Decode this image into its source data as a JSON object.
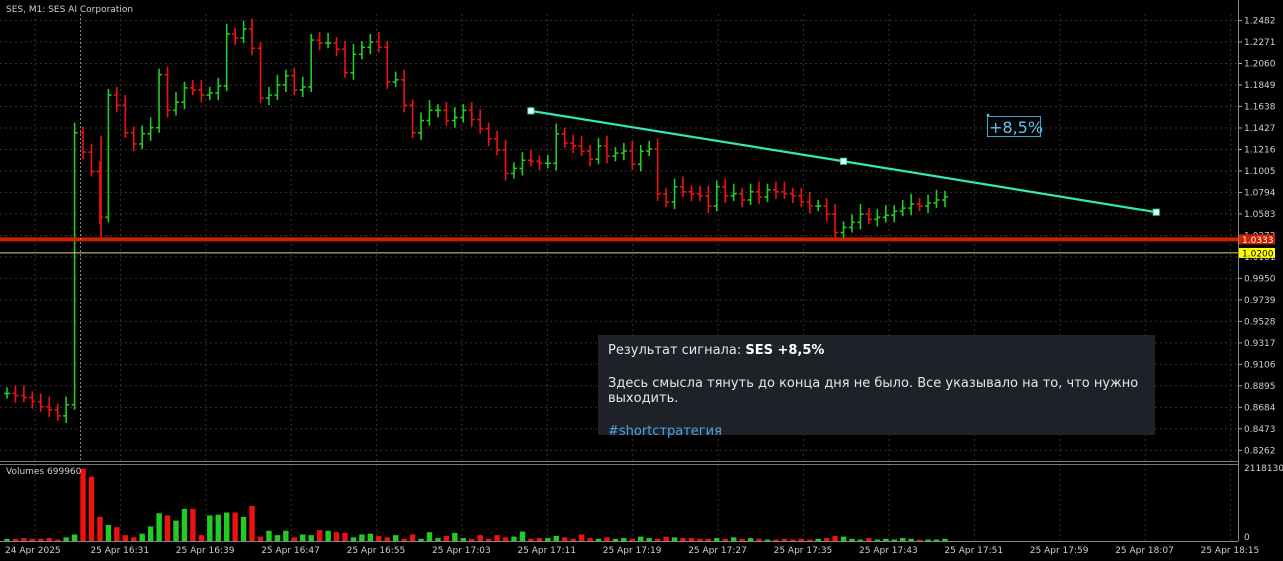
{
  "chart_title": "SES, M1:  SES AI Corporation",
  "volumes_label": "Volumes 699960",
  "percent_label": "+8,5%",
  "signal": {
    "prefix": "Результат сигнала: ",
    "highlight": "SES +8,5%",
    "body": "Здесь смысла тянуть до конца дня не было. Все указывало на то, что нужно выходить.",
    "hashtag": "#shortстратегия"
  },
  "colors": {
    "background": "#000000",
    "bull": "#22cc22",
    "bear": "#ee1111",
    "grid": "#333333",
    "trendline": "#33e8b8",
    "support": "#cc2200",
    "level_line": "#d8d890",
    "level_label_bg": "#ffff00",
    "support_label_bg": "#cc2200"
  },
  "chart_data": {
    "type": "candlestick-bars",
    "price_axis_ticks": [
      "1.2482",
      "1.2271",
      "1.2060",
      "1.1849",
      "1.1638",
      "1.1427",
      "1.1216",
      "1.1005",
      "1.0794",
      "1.0583",
      "1.0372",
      "1.0161",
      "0.9950",
      "0.9739",
      "0.9528",
      "0.9317",
      "0.9106",
      "0.8895",
      "0.8684",
      "0.8473",
      "0.8262"
    ],
    "price_range": [
      0.8157,
      1.2546
    ],
    "price_labels": {
      "support": "1.0333",
      "level": "1.0200"
    },
    "support_price": 1.0333,
    "level_price": 1.02,
    "volume_axis_ticks": [
      "2118130",
      "0"
    ],
    "volume_max": 2118130,
    "time_labels": [
      "24 Apr 2025",
      "25 Apr 16:31",
      "25 Apr 16:39",
      "25 Apr 16:47",
      "25 Apr 16:55",
      "25 Apr 17:03",
      "25 Apr 17:11",
      "25 Apr 17:19",
      "25 Apr 17:27",
      "25 Apr 17:35",
      "25 Apr 17:43",
      "25 Apr 17:51",
      "25 Apr 17:59",
      "25 Apr 18:07",
      "25 Apr 18:15"
    ],
    "closes": [
      0.882,
      0.88,
      0.878,
      0.874,
      0.869,
      0.866,
      0.86,
      0.871,
      1.138,
      1.119,
      1.1,
      1.055,
      1.175,
      1.165,
      1.138,
      1.127,
      1.137,
      1.143,
      1.195,
      1.16,
      1.168,
      1.182,
      1.18,
      1.175,
      1.177,
      1.184,
      1.235,
      1.231,
      1.24,
      1.221,
      1.172,
      1.175,
      1.185,
      1.194,
      1.18,
      1.183,
      1.229,
      1.226,
      1.226,
      1.22,
      1.197,
      1.215,
      1.222,
      1.227,
      1.222,
      1.188,
      1.19,
      1.165,
      1.138,
      1.15,
      1.16,
      1.16,
      1.15,
      1.153,
      1.16,
      1.151,
      1.142,
      1.132,
      1.121,
      1.098,
      1.103,
      1.111,
      1.11,
      1.108,
      1.108,
      1.137,
      1.128,
      1.125,
      1.12,
      1.112,
      1.125,
      1.115,
      1.118,
      1.12,
      1.107,
      1.12,
      1.122,
      1.078,
      1.07,
      1.085,
      1.08,
      1.078,
      1.076,
      1.066,
      1.085,
      1.076,
      1.078,
      1.072,
      1.08,
      1.075,
      1.082,
      1.08,
      1.078,
      1.076,
      1.07,
      1.066,
      1.066,
      1.058,
      1.04,
      1.045,
      1.05,
      1.058,
      1.053,
      1.055,
      1.057,
      1.061,
      1.064,
      1.068,
      1.066,
      1.069,
      1.072,
      1.075
    ],
    "volumes": [
      0.03,
      0.03,
      0.04,
      0.03,
      0.03,
      0.04,
      0.02,
      0.05,
      0.09,
      0.99,
      0.88,
      0.33,
      0.22,
      0.19,
      0.08,
      0.05,
      0.1,
      0.2,
      0.38,
      0.35,
      0.28,
      0.44,
      0.44,
      0.08,
      0.35,
      0.36,
      0.39,
      0.39,
      0.33,
      0.48,
      0.06,
      0.14,
      0.08,
      0.14,
      0.05,
      0.09,
      0.08,
      0.15,
      0.14,
      0.12,
      0.11,
      0.05,
      0.09,
      0.1,
      0.07,
      0.05,
      0.08,
      0.03,
      0.09,
      0.03,
      0.12,
      0.04,
      0.07,
      0.11,
      0.04,
      0.03,
      0.08,
      0.03,
      0.08,
      0.05,
      0.06,
      0.13,
      0.03,
      0.04,
      0.04,
      0.07,
      0.05,
      0.03,
      0.09,
      0.04,
      0.03,
      0.05,
      0.03,
      0.04,
      0.03,
      0.06,
      0.04,
      0.03,
      0.06,
      0.05,
      0.04,
      0.04,
      0.03,
      0.03,
      0.04,
      0.03,
      0.05,
      0.03,
      0.04,
      0.03,
      0.02,
      0.02,
      0.03,
      0.02,
      0.03,
      0.02,
      0.03,
      0.04,
      0.07,
      0.06,
      0.03,
      0.02,
      0.04,
      0.02,
      0.03,
      0.02,
      0.04,
      0.03,
      0.02,
      0.02,
      0.02,
      0.03
    ],
    "trendline": [
      {
        "time_index": 62,
        "price": 1.1595
      },
      {
        "time_index": 99,
        "price": 1.11
      },
      {
        "time_index": 136,
        "price": 1.06
      }
    ],
    "grid": true
  }
}
